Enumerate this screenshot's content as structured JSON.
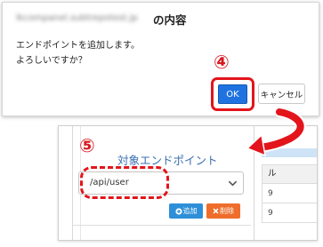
{
  "dialog": {
    "title_blurred": "lkcompanel.subtrepotest.jp",
    "title_suffix": "の内容",
    "message_line1": "エンドポイントを追加します。",
    "message_line2": "よろしいですか？",
    "ok_label": "OK",
    "cancel_label": "キャンセル",
    "step_number": "④"
  },
  "form": {
    "step_number": "⑤",
    "field_title": "対象エンドポイント",
    "select_value": "/api/user",
    "add_label": "追加",
    "delete_label": "削除",
    "table_header": "ル",
    "rows": [
      "9",
      "9"
    ]
  },
  "colors": {
    "accent_red": "#e3141b",
    "ok_blue": "#1e73e0",
    "add_blue": "#2e8fd8",
    "delete_orange": "#ee6d2a",
    "title_blue": "#3b6fb0"
  },
  "icons": {
    "plus": "plus-circle-icon",
    "close": "close-icon",
    "chevron": "chevron-down-icon",
    "arrow": "curved-arrow-icon"
  }
}
